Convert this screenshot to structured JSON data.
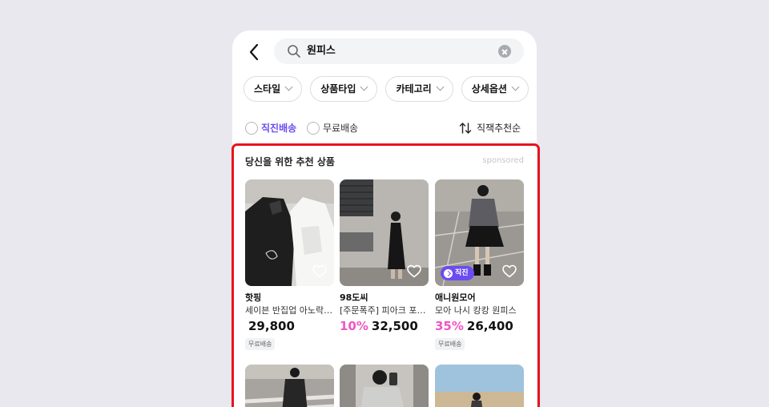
{
  "search": {
    "query": "원피스"
  },
  "filters": [
    "스타일",
    "상품타입",
    "카테고리",
    "상세옵션",
    ""
  ],
  "options": {
    "direct": "직진배송",
    "free": "무료배송",
    "sort": "직잭추천순"
  },
  "section": {
    "title": "당신을 위한 추천 상품",
    "sponsored": "sponsored"
  },
  "products": [
    {
      "brand": "핫핑",
      "name": "세이븐 반집업 아노락 원피스",
      "discount": "",
      "price": "29,800",
      "tag": "무료배송",
      "badge": ""
    },
    {
      "brand": "98도씨",
      "name": "[주문폭주] 피아크 포켓 원피스",
      "discount": "10%",
      "price": "32,500",
      "tag": "",
      "badge": ""
    },
    {
      "brand": "애니원모어",
      "name": "모아 나시 캉캉 원피스",
      "discount": "35%",
      "price": "26,400",
      "tag": "무료배송",
      "badge": "직진"
    }
  ],
  "colors": {
    "accent": "#6b4cf0",
    "discount": "#ef56c4",
    "highlight": "#e8141e"
  }
}
